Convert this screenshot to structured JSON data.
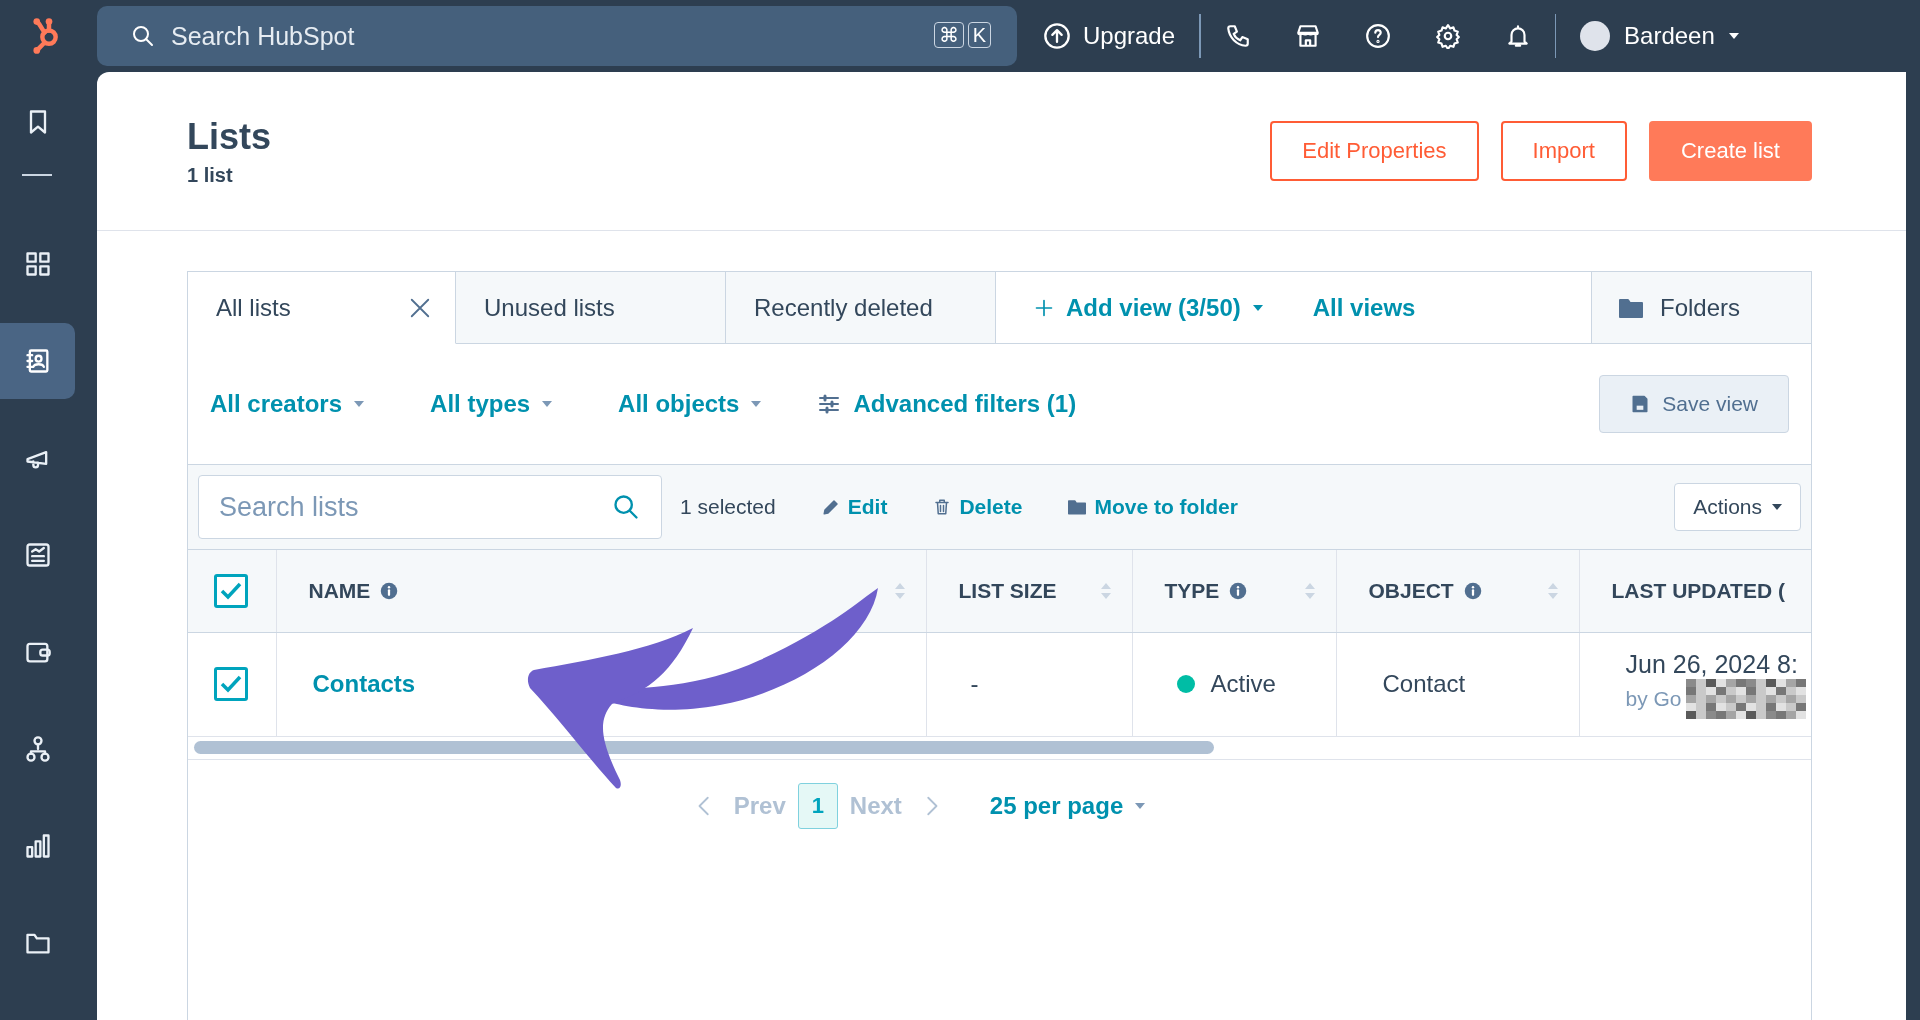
{
  "topbar": {
    "search_placeholder": "Search HubSpot",
    "shortcut_keys": [
      "⌘",
      "K"
    ],
    "upgrade": "Upgrade",
    "icons": [
      {
        "kind": "phone"
      },
      {
        "kind": "store"
      },
      {
        "kind": "help"
      },
      {
        "kind": "settings"
      },
      {
        "kind": "bell"
      }
    ],
    "user": "Bardeen"
  },
  "sidebar": {
    "items": [
      {
        "kind": "bookmark",
        "selected": false
      },
      {
        "kind": "grid",
        "selected": false
      },
      {
        "kind": "contacts",
        "selected": true
      },
      {
        "kind": "megaphone",
        "selected": false
      },
      {
        "kind": "report",
        "selected": false
      },
      {
        "kind": "wallet",
        "selected": false
      },
      {
        "kind": "hierarchy",
        "selected": false
      },
      {
        "kind": "chart",
        "selected": false
      },
      {
        "kind": "folder",
        "selected": false
      }
    ]
  },
  "header": {
    "title": "Lists",
    "count": "1 list",
    "buttons": [
      {
        "label": "Edit Properties",
        "kind": "secondary"
      },
      {
        "label": "Import",
        "kind": "secondary"
      },
      {
        "label": "Create list",
        "kind": "primary"
      }
    ]
  },
  "tabs": [
    {
      "label": "All lists",
      "selected": true,
      "closable": true
    },
    {
      "label": "Unused lists",
      "selected": false,
      "closable": false
    },
    {
      "label": "Recently deleted",
      "selected": false,
      "closable": false
    }
  ],
  "view_controls": {
    "add_view": "Add view (3/50)",
    "all_views": "All views",
    "folders": "Folders"
  },
  "filters": {
    "dropdowns": [
      "All creators",
      "All types",
      "All objects"
    ],
    "advanced_filters": "Advanced filters (1)",
    "save_view": "Save view"
  },
  "toolbar": {
    "search_placeholder": "Search lists",
    "selected_count": "1 selected",
    "actions": [
      {
        "label": "Edit",
        "kind": "edit"
      },
      {
        "label": "Delete",
        "kind": "delete"
      },
      {
        "label": "Move to folder",
        "kind": "move"
      }
    ],
    "actions_menu": "Actions"
  },
  "table": {
    "header_checked": true,
    "columns": [
      {
        "label": "NAME",
        "info": true,
        "sortable": true
      },
      {
        "label": "LIST SIZE",
        "info": false,
        "sortable": true
      },
      {
        "label": "TYPE",
        "info": true,
        "sortable": true
      },
      {
        "label": "OBJECT",
        "info": true,
        "sortable": true
      },
      {
        "label": "LAST UPDATED (",
        "info": false,
        "sortable": false
      }
    ],
    "rows": [
      {
        "checked": true,
        "name": "Contacts",
        "list_size": "-",
        "type": "Active",
        "color": "#00bda5",
        "object": "Contact",
        "last_updated": "Jun 26, 2024 8:",
        "updated_by": "by Go"
      }
    ]
  },
  "pagination": {
    "prev": "Prev",
    "pages": [
      {
        "label": "1",
        "selected": true
      }
    ],
    "next": "Next",
    "per_page": "25 per page"
  }
}
